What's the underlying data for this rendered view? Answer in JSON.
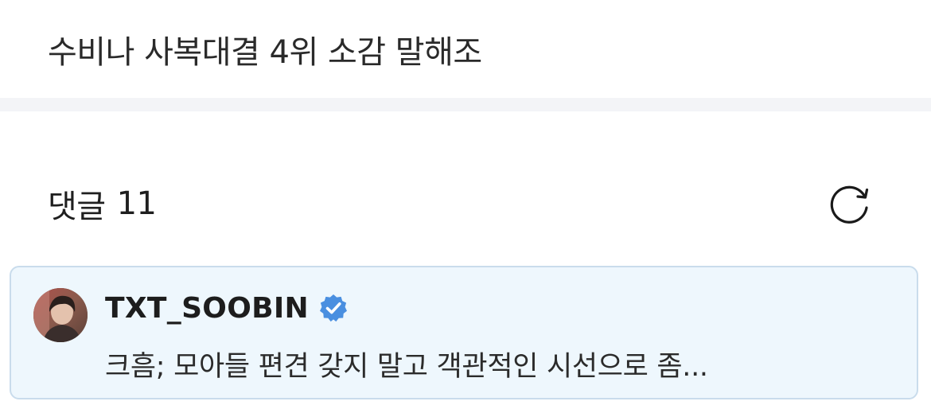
{
  "post": {
    "title": "수비나 사복대결 4위 소감 말해조"
  },
  "comments": {
    "label": "댓글",
    "count": "11",
    "refresh_icon": "refresh-icon"
  },
  "featured_comment": {
    "author": "TXT_SOOBIN",
    "verified_icon": "verified-badge-icon",
    "verified_color": "#4a8fe0",
    "text": "크흠; 모아들 편견 갖지 말고 객관적인 시선으로 좀...",
    "card_background": "#eef7fd",
    "card_border": "#c9dcec"
  }
}
